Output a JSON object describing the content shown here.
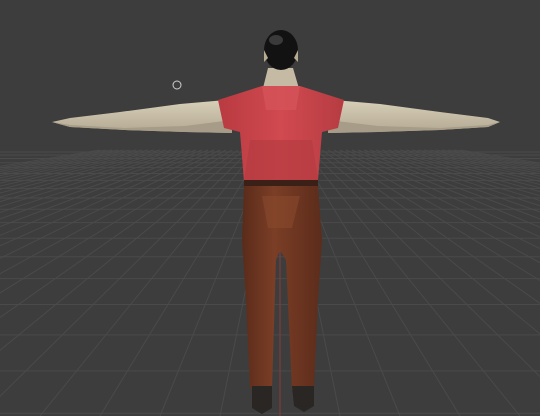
{
  "viewport": {
    "kind": "3d-viewport",
    "background": "#3d3d3d",
    "grid_visible": true,
    "grid_color": "#4a4a4a",
    "axis_y_color": "#8a3a3a",
    "axis_x_color": "#6f8a3a"
  },
  "scene": {
    "object": "character-model",
    "pose": "t-pose",
    "view": "back",
    "colors": {
      "hair": "#121212",
      "skin": "#c9bfa8",
      "shirt": "#c9454b",
      "pants": "#6a3420",
      "shoes": "#2a2624"
    }
  },
  "cursor": {
    "type": "3d-cursor-icon"
  }
}
